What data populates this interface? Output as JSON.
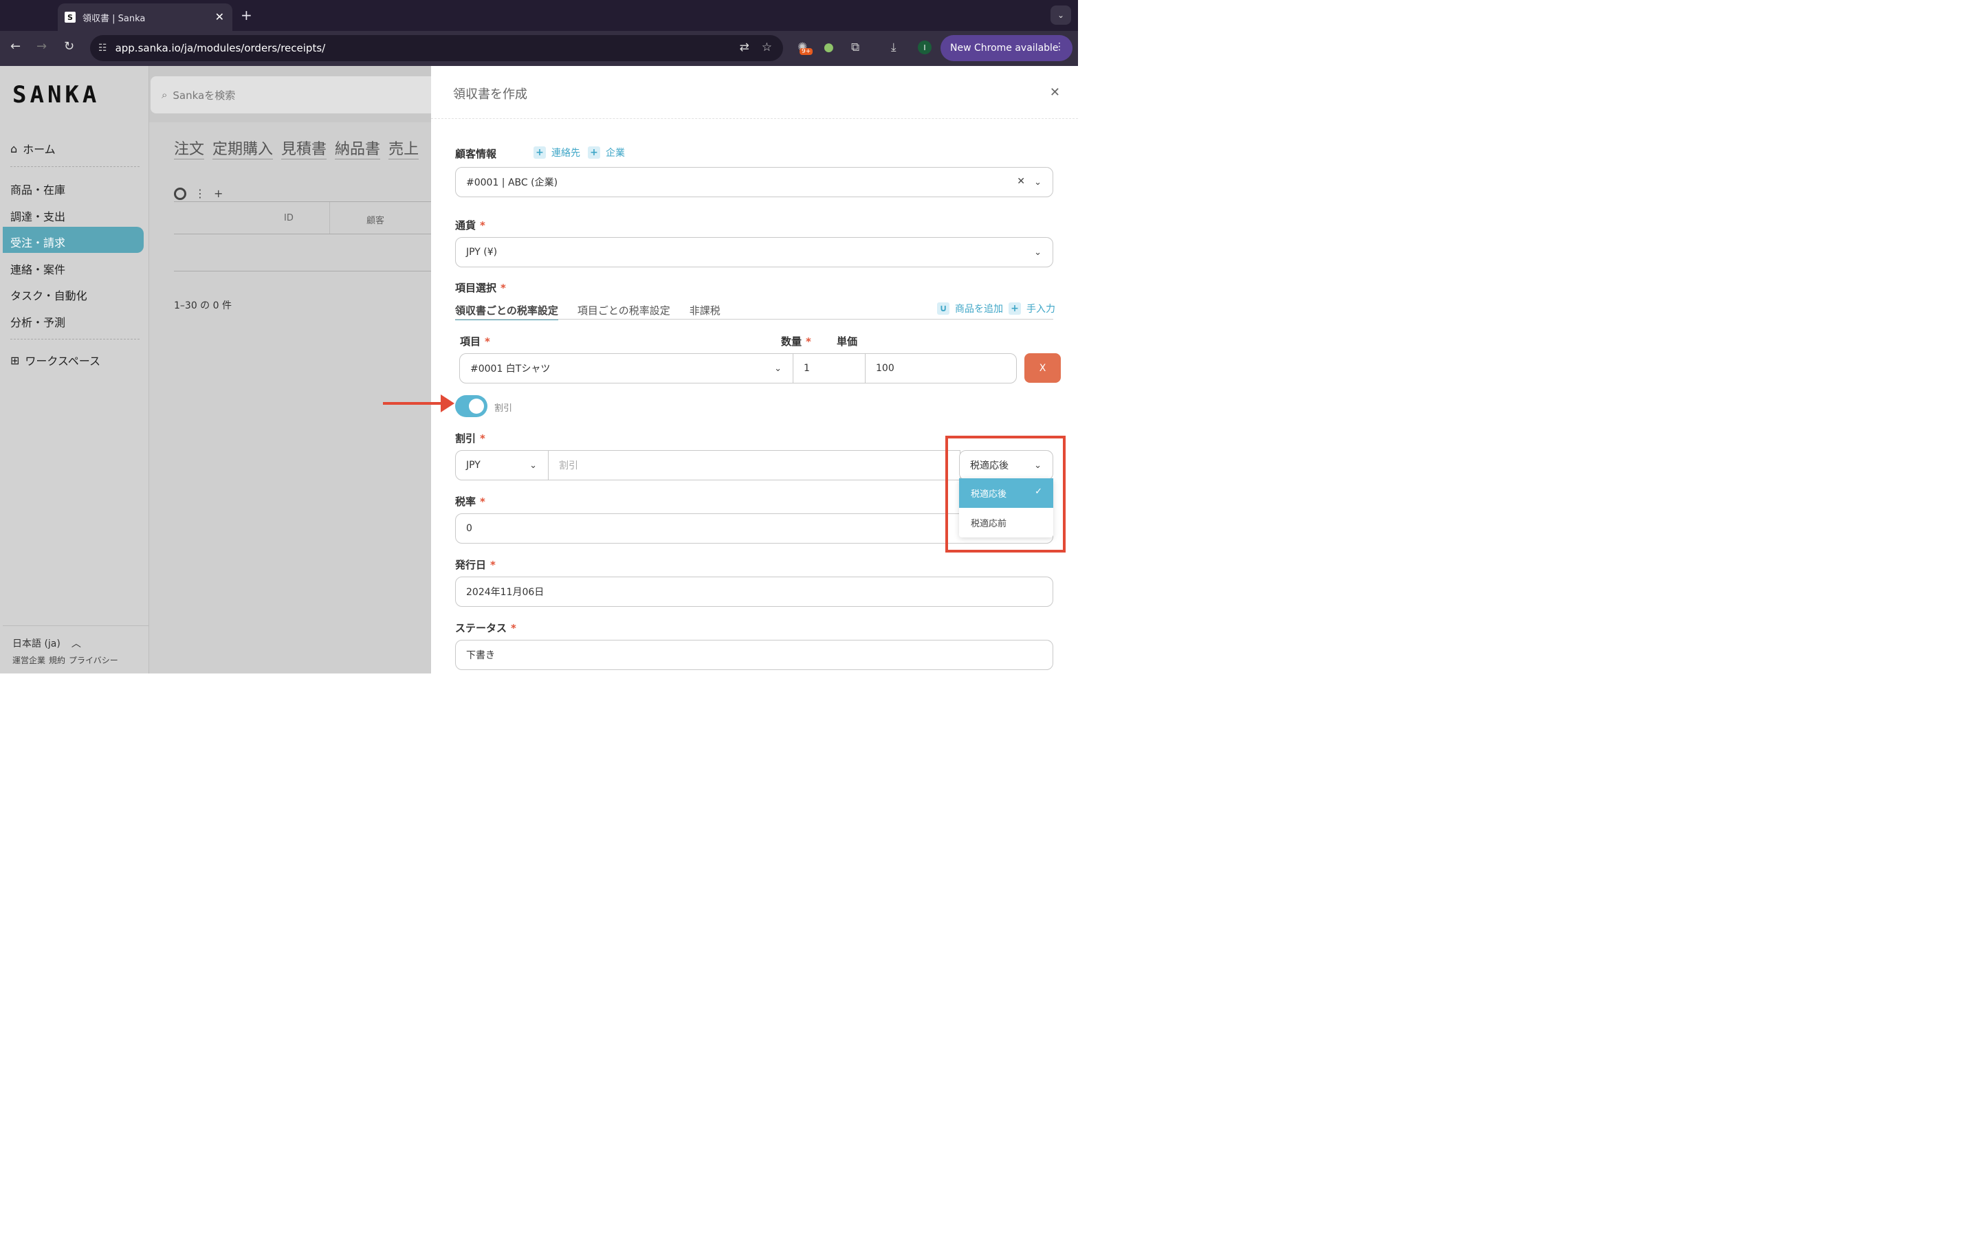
{
  "browser": {
    "tab_title": "領収書 | Sanka",
    "tab_favicon": "S",
    "url": "app.sanka.io/ja/modules/orders/receipts/",
    "ext_badge": "9+",
    "profile_initial": "I",
    "new_chrome": "New Chrome available"
  },
  "app": {
    "logo": "SANKA",
    "search_placeholder": "Sankaを検索",
    "sidebar": {
      "home": "ホーム",
      "items": [
        "商品・在庫",
        "調達・支出",
        "受注・請求",
        "連絡・案件",
        "タスク・自動化",
        "分析・予測"
      ],
      "workspace": "ワークスペース",
      "language": "日本語 (ja)",
      "footer_links": [
        "運営企業",
        "規約",
        "プライバシー"
      ]
    },
    "module_tabs": [
      "注文",
      "定期購入",
      "見積書",
      "納品書",
      "売上"
    ],
    "table": {
      "col_id": "ID",
      "col_customer": "顧客"
    },
    "pager": "1–30 の 0 件"
  },
  "panel": {
    "title": "領収書を作成",
    "customer": {
      "label": "顧客情報",
      "link_contact": "連絡先",
      "link_company": "企業",
      "value": "#0001 | ABC (企業)"
    },
    "currency": {
      "label": "通貨",
      "value": "JPY (¥)"
    },
    "items": {
      "label": "項目選択",
      "tabs": [
        "領収書ごとの税率設定",
        "項目ごとの税率設定",
        "非課税"
      ],
      "add_product": "商品を追加",
      "manual": "手入力",
      "col_item": "項目",
      "col_qty": "数量",
      "col_price": "単価",
      "row": {
        "item": "#0001 白Tシャツ",
        "qty": "1",
        "price": "100",
        "remove": "X"
      }
    },
    "discount_toggle_label": "割引",
    "discount": {
      "label": "割引",
      "currency": "JPY",
      "placeholder": "割引",
      "timing": "税適応後",
      "options": [
        "税適応後",
        "税適応前"
      ]
    },
    "tax": {
      "label": "税率",
      "value": "0"
    },
    "issue_date": {
      "label": "発行日",
      "value": "2024年11月06日"
    },
    "status": {
      "label": "ステータス",
      "value": "下書き"
    }
  },
  "required_mark": "*",
  "colors": {
    "accent": "#5ab6d3",
    "annotation": "#e24a36",
    "remove": "#e2704f"
  }
}
